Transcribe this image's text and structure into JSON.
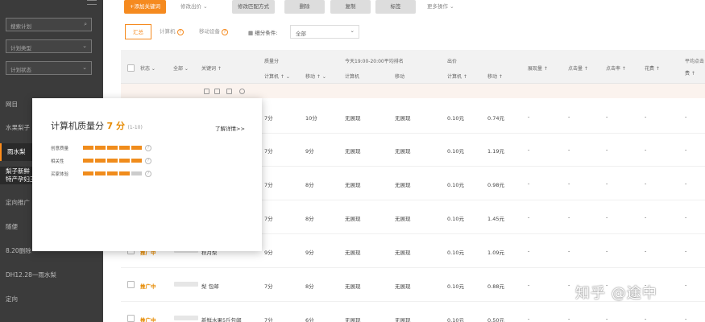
{
  "sidebar": {
    "search_placeholder": "搜索计划",
    "plan_type": "计划类型",
    "plan_status": "计划状态",
    "items": [
      "网目",
      "水果梨子",
      "雨水梨",
      "梨子新鲜",
      "特产孕妇王",
      "定向推广",
      "随便",
      "8.20删除",
      "DH12.28一雨水梨",
      "定向"
    ]
  },
  "toolbar": {
    "add_keyword": "+添加关键词",
    "edit_bid": "修改出价",
    "edit_match": "修改匹配方式",
    "delete": "删除",
    "copy": "复制",
    "tag": "标签",
    "more": "更多操作"
  },
  "filters": {
    "tab_summary": "汇总",
    "tab_computer": "计算机",
    "tab_mobile": "移动设备",
    "segment_label": "细分条件:",
    "segment_value": "全部"
  },
  "table": {
    "headers": {
      "status": "状态",
      "all": "全部",
      "keyword": "关键词",
      "quality": "质量分",
      "quality_pc": "计算机",
      "quality_mobile": "移动",
      "rank": "今天19:00-20:00平均排名",
      "rank_pc": "计算机",
      "rank_mobile": "移动",
      "bid": "出价",
      "bid_pc": "计算机",
      "bid_mobile": "移动",
      "impressions": "展现量",
      "clicks": "点击量",
      "ctr": "点击率",
      "cost": "花费",
      "avg": "平均点击",
      "avg2": "费"
    },
    "rows": [
      {
        "status": "",
        "keyword": "",
        "q_pc": "7分",
        "q_mob": "10分",
        "r_pc": "无展现",
        "r_mob": "无展现",
        "b_pc": "0.10元",
        "b_mob": "0.74元"
      },
      {
        "status": "",
        "keyword": "",
        "q_pc": "7分",
        "q_mob": "9分",
        "r_pc": "无展现",
        "r_mob": "无展现",
        "b_pc": "0.10元",
        "b_mob": "1.19元"
      },
      {
        "status": "",
        "keyword": "",
        "q_pc": "7分",
        "q_mob": "8分",
        "r_pc": "无展现",
        "r_mob": "无展现",
        "b_pc": "0.10元",
        "b_mob": "0.98元"
      },
      {
        "status": "",
        "keyword": "",
        "q_pc": "7分",
        "q_mob": "8分",
        "r_pc": "无展现",
        "r_mob": "无展现",
        "b_pc": "0.10元",
        "b_mob": "1.45元"
      },
      {
        "status": "推广中",
        "keyword": "秋月梨",
        "q_pc": "9分",
        "q_mob": "9分",
        "r_pc": "无展现",
        "r_mob": "无展现",
        "b_pc": "0.10元",
        "b_mob": "1.09元"
      },
      {
        "status": "推广中",
        "keyword": "梨 包邮",
        "q_pc": "7分",
        "q_mob": "8分",
        "r_pc": "无展现",
        "r_mob": "无展现",
        "b_pc": "0.10元",
        "b_mob": "0.88元"
      },
      {
        "status": "推广中",
        "keyword": "新鲜水果5斤包邮",
        "q_pc": "7分",
        "q_mob": "6分",
        "r_pc": "无展现",
        "r_mob": "无展现",
        "b_pc": "0.10元",
        "b_mob": "0.50元"
      }
    ],
    "dash": "-"
  },
  "popup": {
    "title": "计算机质量分",
    "score": "7",
    "unit": "分",
    "range": "(1-10)",
    "details_link": "了解详情>>",
    "metrics": [
      {
        "label": "创意质量",
        "filled": 5
      },
      {
        "label": "相关性",
        "filled": 5
      },
      {
        "label": "买家体验",
        "filled": 4
      }
    ]
  },
  "watermark": "知乎 @途中",
  "colors": {
    "accent": "#f58a1f",
    "sidebar": "#3b3b3b"
  }
}
